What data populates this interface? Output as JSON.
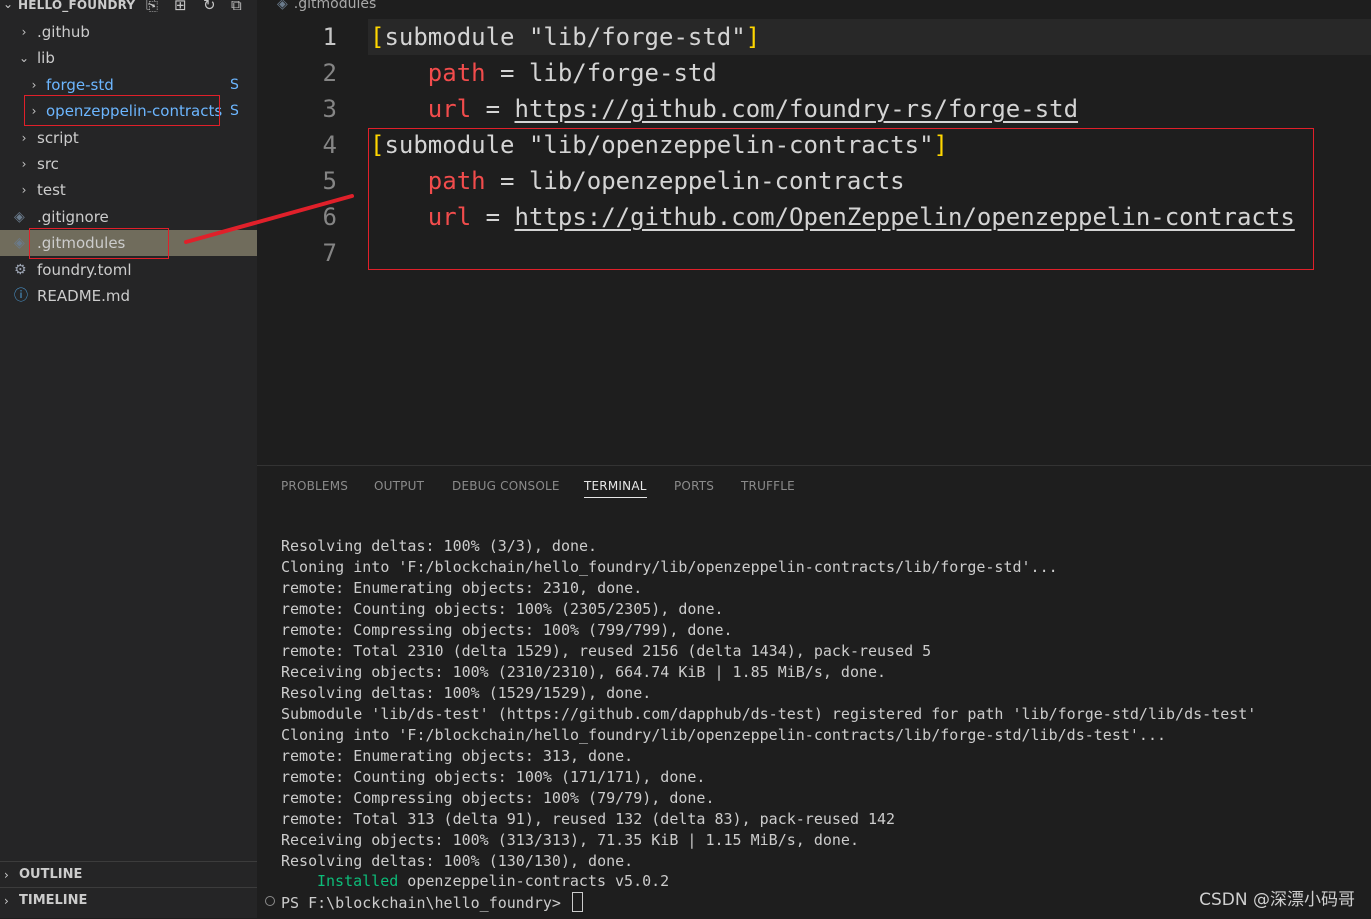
{
  "explorer": {
    "title": "HELLO_FOUNDRY",
    "tree": [
      {
        "label": ".github",
        "type": "folder",
        "expanded": false,
        "depth": 1
      },
      {
        "label": "lib",
        "type": "folder",
        "expanded": true,
        "depth": 1
      },
      {
        "label": "forge-std",
        "type": "submodule",
        "expanded": false,
        "depth": 2,
        "status": "S"
      },
      {
        "label": "openzeppelin-contracts",
        "type": "submodule",
        "expanded": false,
        "depth": 2,
        "status": "S"
      },
      {
        "label": "script",
        "type": "folder",
        "expanded": false,
        "depth": 1
      },
      {
        "label": "src",
        "type": "folder",
        "expanded": false,
        "depth": 1
      },
      {
        "label": "test",
        "type": "folder",
        "expanded": false,
        "depth": 1
      },
      {
        "label": ".gitignore",
        "type": "git-file",
        "depth": 1
      },
      {
        "label": ".gitmodules",
        "type": "git-file",
        "depth": 1,
        "selected": true
      },
      {
        "label": "foundry.toml",
        "type": "gear-file",
        "depth": 1
      },
      {
        "label": "README.md",
        "type": "info-file",
        "depth": 1
      }
    ],
    "outline_label": "OUTLINE",
    "timeline_label": "TIMELINE"
  },
  "editor": {
    "breadcrumb": ".gitmodules",
    "lines": [
      {
        "n": "1",
        "bracket_open": "[",
        "text": "submodule \"lib/forge-std\"",
        "bracket_close": "]"
      },
      {
        "n": "2",
        "key": "path",
        "eq": " = ",
        "value": "lib/forge-std"
      },
      {
        "n": "3",
        "key": "url",
        "eq": " = ",
        "url": "https://github.com/foundry-rs/forge-std"
      },
      {
        "n": "4",
        "bracket_open": "[",
        "text": "submodule \"lib/openzeppelin-contracts\"",
        "bracket_close": "]"
      },
      {
        "n": "5",
        "key": "path",
        "eq": " = ",
        "value": "lib/openzeppelin-contracts"
      },
      {
        "n": "6",
        "key": "url",
        "eq": " = ",
        "url": "https://github.com/OpenZeppelin/openzeppelin-contracts"
      },
      {
        "n": "7"
      }
    ]
  },
  "panel": {
    "tabs": [
      "PROBLEMS",
      "OUTPUT",
      "DEBUG CONSOLE",
      "TERMINAL",
      "PORTS",
      "TRUFFLE"
    ],
    "active_tab": "TERMINAL",
    "terminal_lines": [
      "Resolving deltas: 100% (3/3), done.",
      "Cloning into 'F:/blockchain/hello_foundry/lib/openzeppelin-contracts/lib/forge-std'...",
      "remote: Enumerating objects: 2310, done.",
      "remote: Counting objects: 100% (2305/2305), done.",
      "remote: Compressing objects: 100% (799/799), done.",
      "remote: Total 2310 (delta 1529), reused 2156 (delta 1434), pack-reused 5",
      "Receiving objects: 100% (2310/2310), 664.74 KiB | 1.85 MiB/s, done.",
      "Resolving deltas: 100% (1529/1529), done.",
      "Submodule 'lib/ds-test' (https://github.com/dapphub/ds-test) registered for path 'lib/forge-std/lib/ds-test'",
      "Cloning into 'F:/blockchain/hello_foundry/lib/openzeppelin-contracts/lib/forge-std/lib/ds-test'...",
      "remote: Enumerating objects: 313, done.",
      "remote: Counting objects: 100% (171/171), done.",
      "remote: Compressing objects: 100% (79/79), done.",
      "remote: Total 313 (delta 91), reused 132 (delta 83), pack-reused 142",
      "Receiving objects: 100% (313/313), 71.35 KiB | 1.15 MiB/s, done.",
      "Resolving deltas: 100% (130/130), done."
    ],
    "installed_word": "Installed",
    "installed_rest": " openzeppelin-contracts v5.0.2",
    "prompt": "PS F:\\blockchain\\hello_foundry> "
  },
  "watermark": "CSDN @深漂小码哥",
  "colors": {
    "annotation_red": "#e0202a",
    "selected_row": "#706c5c",
    "submodule_blue": "#6cb6ff",
    "key_red": "#f14c4c",
    "bracket_gold": "#ffd700",
    "installed_green": "#0dbc79"
  }
}
